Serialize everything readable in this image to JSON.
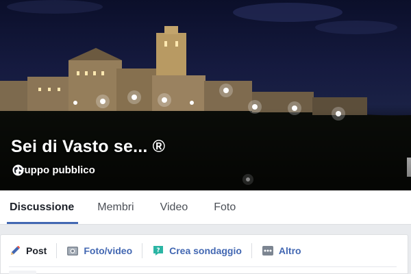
{
  "group": {
    "name": "Sei di Vasto se... ®",
    "privacy": "Gruppo pubblico"
  },
  "tabs": [
    {
      "label": "Discussione",
      "active": true
    },
    {
      "label": "Membri",
      "active": false
    },
    {
      "label": "Video",
      "active": false
    },
    {
      "label": "Foto",
      "active": false
    }
  ],
  "composer": {
    "post": "Post",
    "photo_video": "Foto/video",
    "poll": "Crea sondaggio",
    "more": "Altro"
  },
  "colors": {
    "accent": "#4267b2",
    "poll_icon": "#2bb5a4",
    "tab_active_text": "#1d2129"
  },
  "icons": {
    "privacy": "globe-icon",
    "post": "pencil-icon",
    "photo_video": "camera-icon",
    "poll": "poll-bubble-icon",
    "more": "more-dots-icon"
  }
}
